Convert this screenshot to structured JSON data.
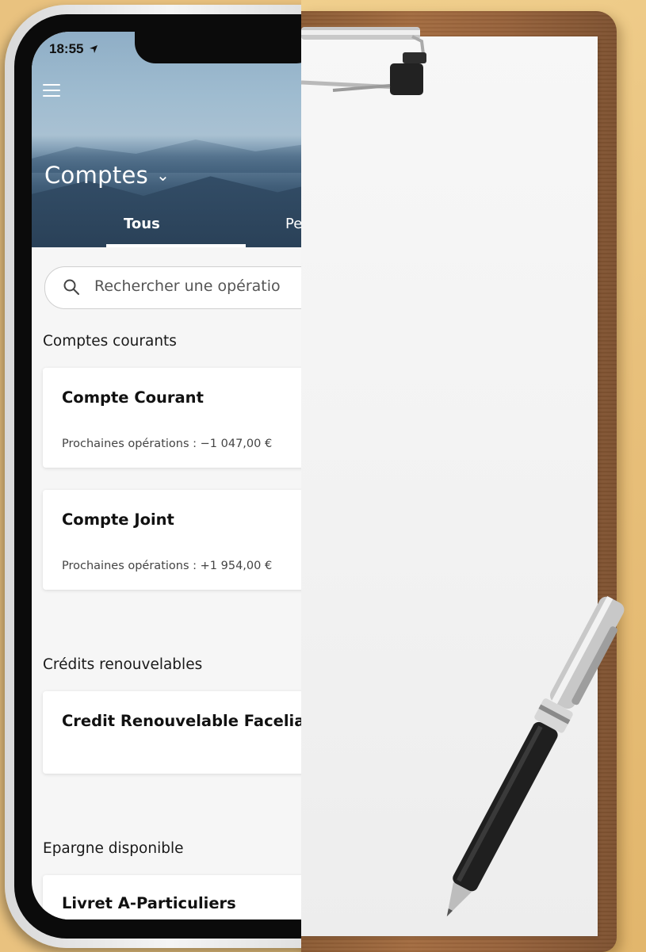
{
  "status_bar": {
    "time": "18:55"
  },
  "header": {
    "title": "Comptes",
    "tabs": [
      {
        "label": "Tous",
        "active": true
      },
      {
        "label": "Pe",
        "active": false
      }
    ]
  },
  "search": {
    "placeholder": "Rechercher une opératio"
  },
  "sections": [
    {
      "label": "Comptes courants",
      "accounts": [
        {
          "name": "Compte Courant",
          "upcoming": "Prochaines opérations : −1 047,00 €"
        },
        {
          "name": "Compte Joint",
          "upcoming": "Prochaines opérations : +1 954,00 €"
        }
      ]
    },
    {
      "label": "Crédits renouvelables",
      "accounts": [
        {
          "name": "Credit Renouvelable Facelia"
        }
      ]
    },
    {
      "label": "Epargne disponible",
      "accounts": [
        {
          "name": "Livret A-Particuliers"
        }
      ]
    }
  ],
  "colors": {
    "hero_sky": "#9fbcd0",
    "hero_mountain": "#2a4158",
    "screen_bg": "#f6f6f6",
    "desk": "#e8c07b",
    "clipboard_wood": "#a26b3f",
    "paper": "#f3f3f3"
  },
  "icons": {
    "menu": "hamburger-menu-icon",
    "dropdown": "chevron-down-icon",
    "search": "magnifier-icon",
    "location": "location-arrow-icon"
  }
}
